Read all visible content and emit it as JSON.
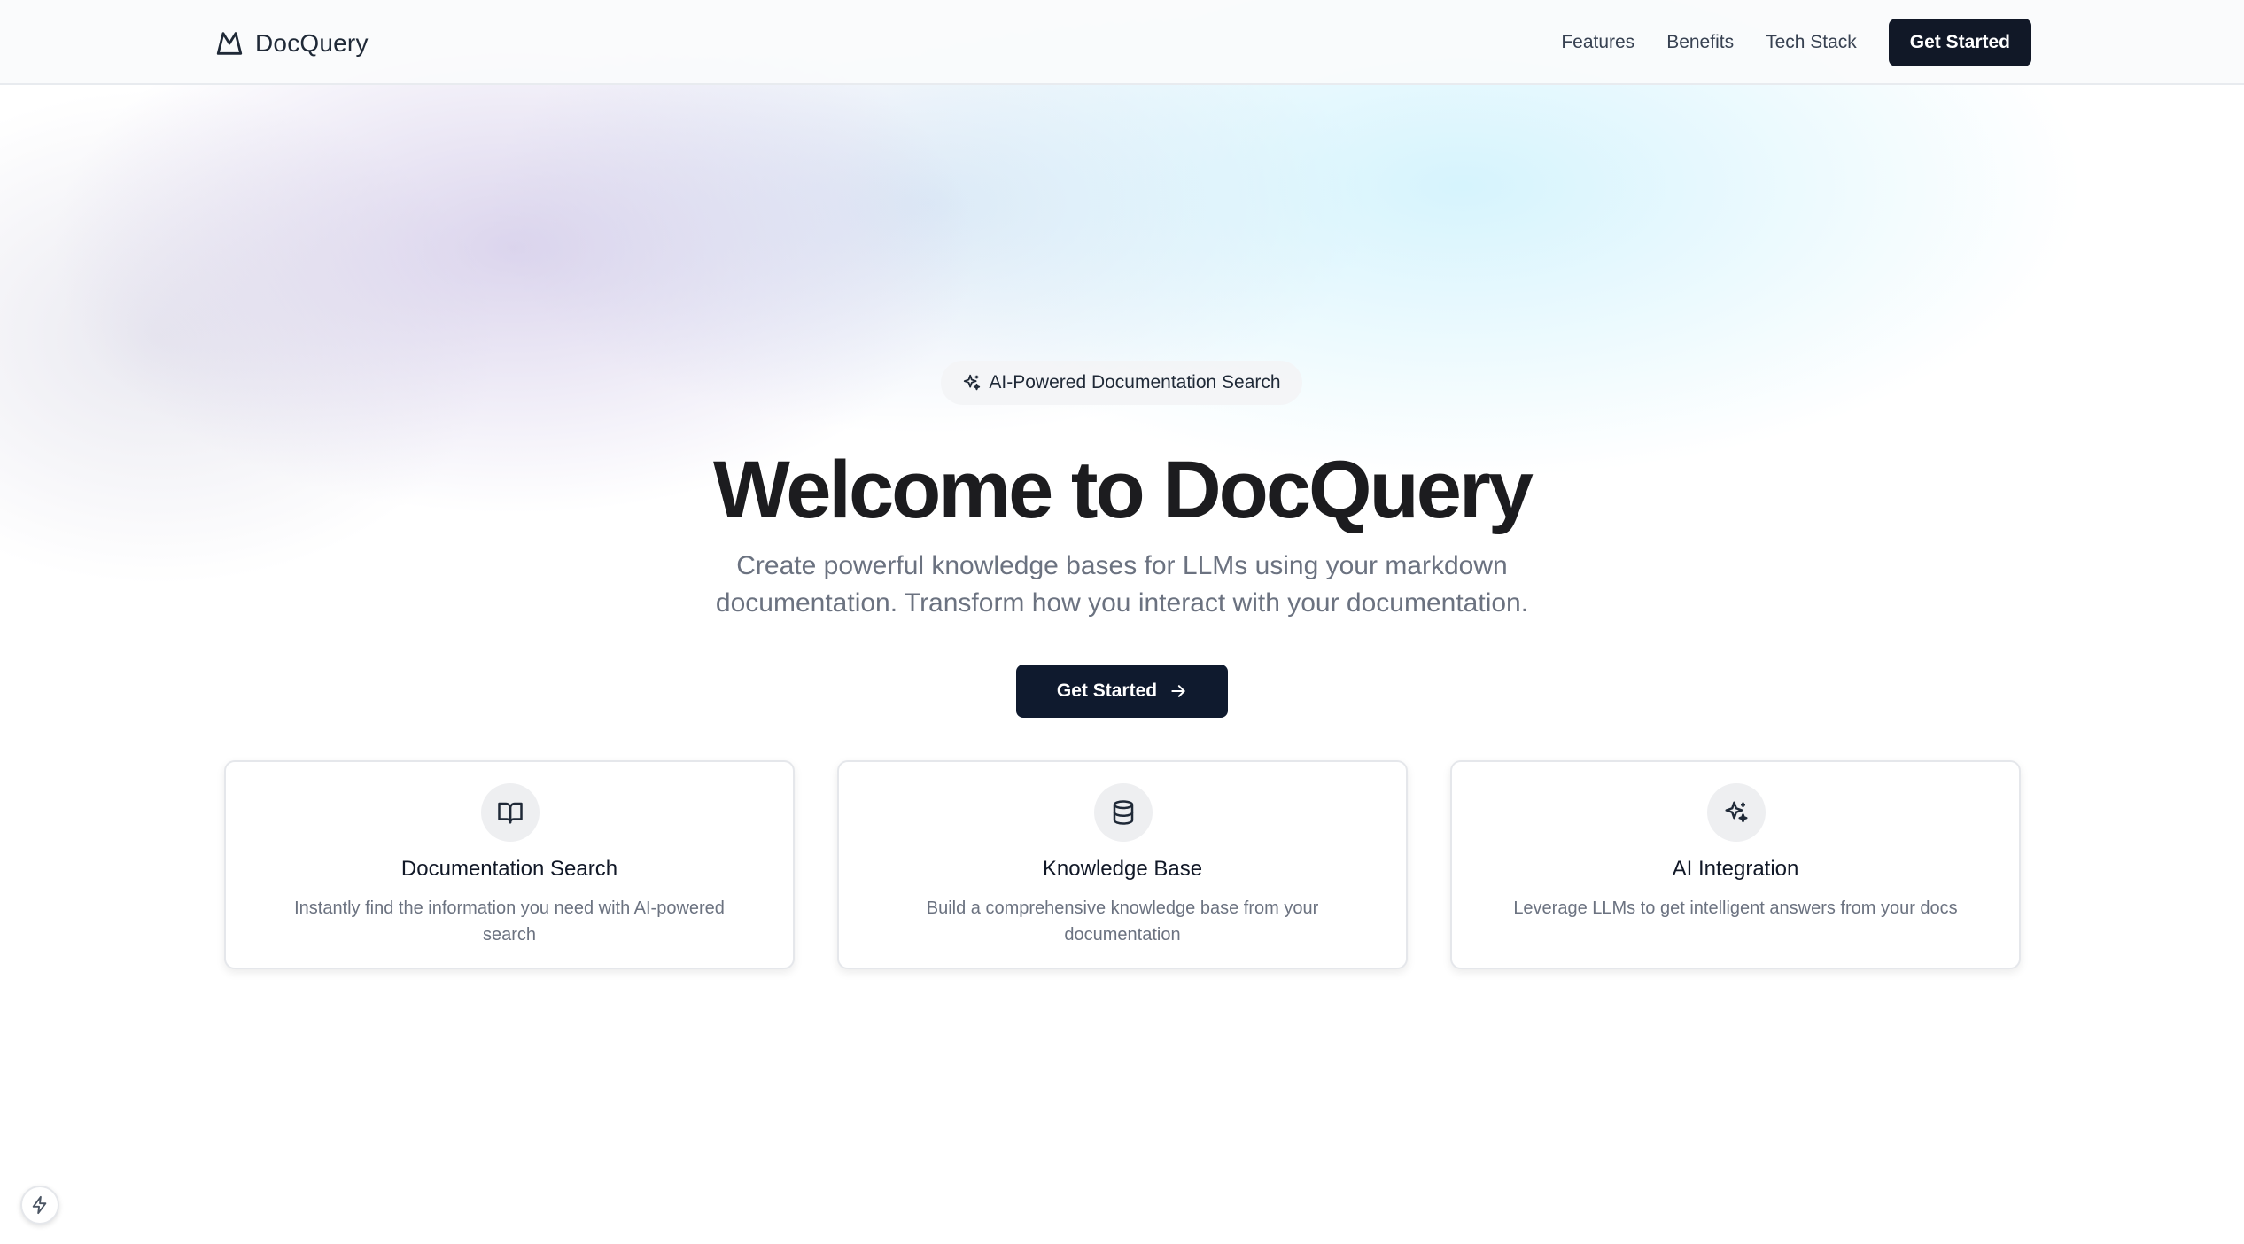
{
  "nav": {
    "brand_name": "DocQuery",
    "brand_icon": "mountain-logo-icon",
    "links": [
      "Features",
      "Benefits",
      "Tech Stack"
    ],
    "cta_label": "Get Started"
  },
  "hero": {
    "badge_icon": "sparkles-icon",
    "badge_text": "AI-Powered Documentation Search",
    "title": "Welcome to DocQuery",
    "subtitle": "Create powerful knowledge bases for LLMs using your markdown documentation. Transform how you interact with your documentation.",
    "cta_label": "Get Started",
    "cta_icon": "arrow-right-icon"
  },
  "features": [
    {
      "icon": "book-open-icon",
      "title": "Documentation Search",
      "description": "Instantly find the information you need with AI-powered search"
    },
    {
      "icon": "database-icon",
      "title": "Knowledge Base",
      "description": "Build a comprehensive knowledge base from your documentation"
    },
    {
      "icon": "sparkles-icon",
      "title": "AI Integration",
      "description": "Leverage LLMs to get intelligent answers from your docs"
    }
  ],
  "corner_button": {
    "icon": "lightning-bolt-icon"
  },
  "colors": {
    "primary_button": "#111827",
    "hero_title": "#1c1c1f",
    "muted_text": "#6b7280",
    "icon_circle": "#eeeff1"
  }
}
